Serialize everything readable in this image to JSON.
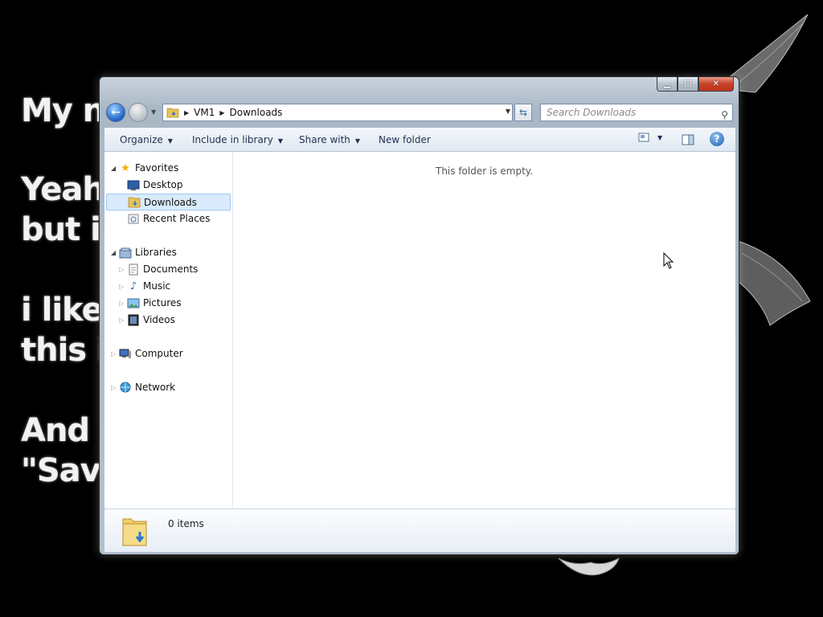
{
  "desktop": {
    "lines": [
      "My na",
      "Yeah,",
      "but it",
      "i like",
      "this is",
      "And n",
      "\"Save"
    ]
  },
  "window": {
    "caption_buttons": {
      "minimize": "▁",
      "maximize": "□",
      "close": "✕"
    },
    "address": {
      "crumbs": [
        "VM1",
        "Downloads"
      ],
      "search_placeholder": "Search Downloads"
    },
    "toolbar": {
      "organize": "Organize",
      "include_in_library": "Include in library",
      "share_with": "Share with",
      "new_folder": "New folder"
    },
    "nav": {
      "favorites": {
        "label": "Favorites",
        "items": [
          "Desktop",
          "Downloads",
          "Recent Places"
        ]
      },
      "libraries": {
        "label": "Libraries",
        "items": [
          "Documents",
          "Music",
          "Pictures",
          "Videos"
        ]
      },
      "computer": "Computer",
      "network": "Network"
    },
    "main": {
      "empty_message": "This folder is empty."
    },
    "details": {
      "item_count": "0 items"
    }
  }
}
